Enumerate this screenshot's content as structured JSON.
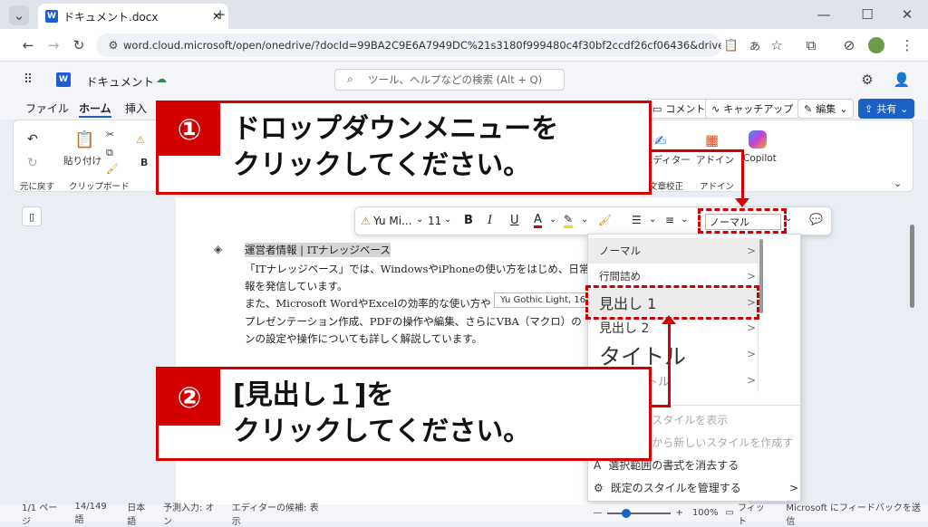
{
  "browser": {
    "tab_title": "ドキュメント.docx",
    "url": "word.cloud.microsoft/open/onedrive/?docId=99BA2C9E6A7949DC%21s3180f999480c4f30bf2ccdf26cf06436&driveId=99BA2C9E6A7..."
  },
  "app": {
    "doc_title": "ドキュメント",
    "search_placeholder": "ツール、ヘルプなどの検索 (Alt + Q)"
  },
  "menu": {
    "file": "ファイル",
    "home": "ホーム",
    "insert": "挿入",
    "comment": "コメント",
    "catchup": "キャッチアップ",
    "edit": "編集",
    "share": "共有"
  },
  "ribbon": {
    "undo_group": "元に戻す",
    "paste": "貼り付け",
    "clipboard": "クリップボード",
    "editor": "エディター",
    "proofing": "文章校正",
    "addin": "アドイン",
    "addin_group": "アドイン",
    "copilot": "Copilot"
  },
  "toolbar": {
    "font": "Yu Mi...",
    "size": "11",
    "style_value": "ノーマル"
  },
  "doc": {
    "heading": "運営者情報 | ITナレッジベース",
    "line1": "「ITナレッジベース」では、WindowsやiPhoneの使い方をはじめ、日常",
    "line2": "報を発信しています。",
    "line3": "また、Microsoft WordやExcelの効率的な使い方やト",
    "line4": "プレゼンテーション作成、PDFの操作や編集、さらにVBA（マクロ）の",
    "line5": "ンの設定や操作についても詳しく解説しています。",
    "tooltip": "Yu Gothic Light, 16"
  },
  "styles": {
    "items": [
      {
        "label": "ノーマル"
      },
      {
        "label": "行間詰め"
      },
      {
        "label": "見出し 1"
      },
      {
        "label": "見出し 2"
      },
      {
        "label": "タイトル"
      },
      {
        "label": "サブタイトル"
      }
    ],
    "actions": [
      "その他のスタイルを表示",
      "選択範囲から新しいスタイルを作成する",
      "選択範囲の書式を消去する",
      "既定のスタイルを管理する"
    ]
  },
  "callouts": {
    "c1_num": "①",
    "c1_text": "ドロップダウンメニューを\nクリックしてください。",
    "c2_num": "②",
    "c2_text": "[見出し１]を\nクリックしてください。"
  },
  "status": {
    "page": "1/1 ページ",
    "words": "14/149 語",
    "lang": "日本語",
    "predict": "予測入力: オン",
    "editor": "エディターの候補: 表示",
    "zoom": "100%",
    "fit": "フィット",
    "feedback": "Microsoft にフィードバックを送信"
  },
  "colors": {
    "accent": "#d40000",
    "brand": "#1c62c6"
  }
}
